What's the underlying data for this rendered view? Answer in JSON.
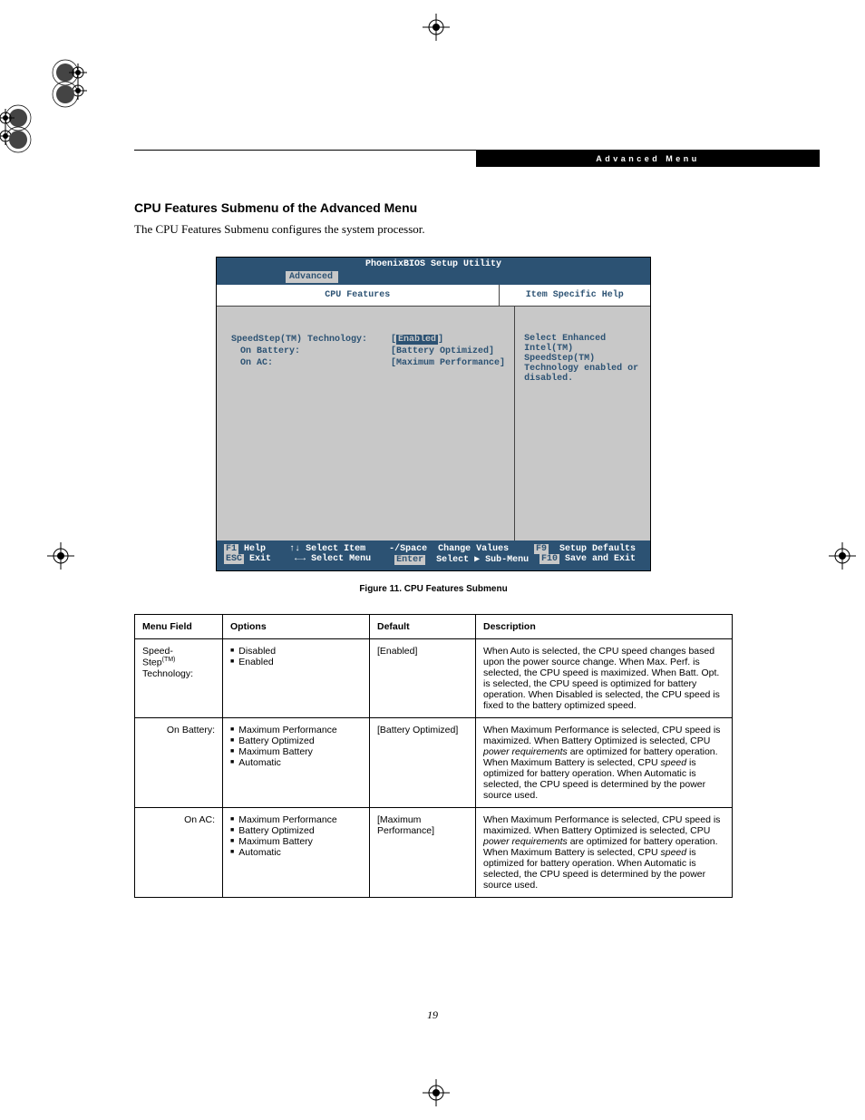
{
  "header": {
    "label": "Advanced Menu"
  },
  "section": {
    "title": "CPU Features Submenu of the Advanced Menu",
    "intro": "The CPU Features Submenu configures the system processor."
  },
  "bios": {
    "title": "PhoenixBIOS Setup Utility",
    "tab": "Advanced",
    "left_header": "CPU Features",
    "right_header": "Item Specific Help",
    "fields": {
      "speedstep_label": "SpeedStep(TM) Technology:",
      "speedstep_value": "Enabled",
      "on_battery_label": "On Battery:",
      "on_battery_value": "[Battery Optimized]",
      "on_ac_label": "On AC:",
      "on_ac_value": "[Maximum Performance]"
    },
    "help_text": "Select Enhanced Intel(TM) SpeedStep(TM) Technology enabled or disabled.",
    "footer": {
      "f1": "F1",
      "f1_label": "Help",
      "updown": "↑↓",
      "updown_label": "Select Item",
      "pm": "-/Space",
      "pm_label": "Change Values",
      "f9": "F9",
      "f9_label": "Setup Defaults",
      "esc": "ESC",
      "esc_label": "Exit",
      "lr": "←→",
      "lr_label": "Select Menu",
      "enter": "Enter",
      "enter_label": "Select ▶ Sub-Menu",
      "f10": "F10",
      "f10_label": "Save and Exit"
    }
  },
  "figure_caption": "Figure 11.  CPU Features Submenu",
  "table": {
    "headers": {
      "mf": "Menu Field",
      "op": "Options",
      "df": "Default",
      "de": "Description"
    },
    "rows": [
      {
        "mf_html": "Speed-<br>Step<sup class=\"tm\">(TM)</sup><br>Technology:",
        "options": [
          "Disabled",
          "Enabled"
        ],
        "default": "[Enabled]",
        "desc_html": "When Auto is selected, the CPU speed changes based upon the power source change. When Max. Perf. is selected, the CPU speed is maximized. When Batt. Opt. is selected, the CPU speed is optimized for battery operation. When Disabled is selected, the CPU speed is fixed to the battery optimized speed."
      },
      {
        "mf_html": "On Battery:",
        "options": [
          "Maximum Performance",
          "Battery Optimized",
          "Maximum Battery",
          "Automatic"
        ],
        "default": "[Battery Optimized]",
        "desc_html": "When Maximum Performance is selected, CPU speed is maximized. When Battery Optimized is selected, CPU <em>power requirements</em> are optimized for battery operation. When Maximum Battery is selected, CPU <em>speed</em> is optimized for battery operation. When Automatic is selected, the CPU speed is determined by the power source used."
      },
      {
        "mf_html": "On AC:",
        "options": [
          "Maximum Performance",
          "Battery Optimized",
          "Maximum Battery",
          "Automatic"
        ],
        "default": "[Maximum Performance]",
        "desc_html": "When Maximum Performance is selected, CPU speed is maximized. When Battery Optimized is selected, CPU <em>power requirements</em> are optimized for battery operation. When Maximum Battery is selected, CPU <em>speed</em> is optimized for battery operation. When Automatic is selected, the CPU speed is determined by the power source used."
      }
    ]
  },
  "page_number": "19"
}
